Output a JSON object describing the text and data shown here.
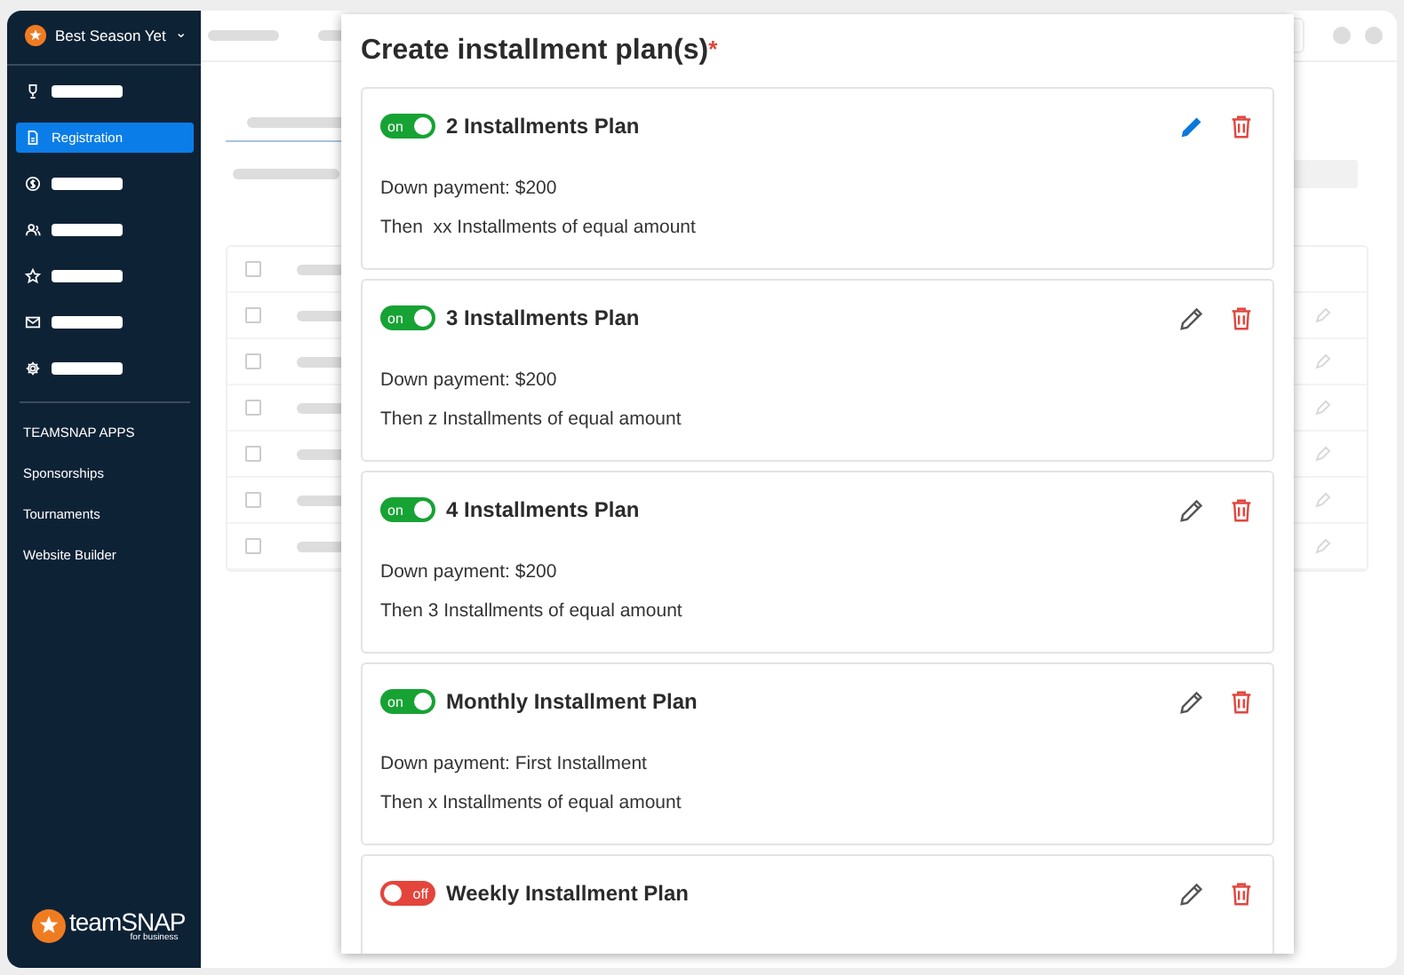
{
  "sidebar": {
    "org": {
      "name": "Best Season Yet",
      "caret": "⌄"
    },
    "nav": [
      {
        "kind": "trophy",
        "selected": false
      },
      {
        "kind": "document",
        "label": "Registration",
        "selected": true
      },
      {
        "kind": "dollar",
        "selected": false
      },
      {
        "kind": "people",
        "selected": false
      },
      {
        "kind": "star",
        "selected": false
      },
      {
        "kind": "mail",
        "selected": false
      },
      {
        "kind": "gear",
        "selected": false
      }
    ],
    "apps_heading": "TEAMSNAP APPS",
    "apps": [
      "Sponsorships",
      "Tournaments",
      "Website Builder"
    ],
    "logo": {
      "name": "team**SNAP**",
      "tagline": "for business"
    }
  },
  "modal": {
    "title": "Create installment plan(s)",
    "required_mark": "*",
    "plans": [
      {
        "on": true,
        "toggle_label": "on",
        "title": "2 Installments Plan",
        "edit_active": true,
        "lines": [
          "Down payment: $200",
          "Then  xx Installments of equal amount"
        ]
      },
      {
        "on": true,
        "toggle_label": "on",
        "title": "3 Installments Plan",
        "edit_active": false,
        "lines": [
          "Down payment: $200",
          "Then z Installments of equal amount"
        ]
      },
      {
        "on": true,
        "toggle_label": "on",
        "title": "4 Installments Plan",
        "edit_active": false,
        "lines": [
          "Down payment: $200",
          "Then 3 Installments of equal amount"
        ]
      },
      {
        "on": true,
        "toggle_label": "on",
        "title": "Monthly Installment Plan",
        "edit_active": false,
        "lines": [
          "Down payment: First Installment",
          "Then x Installments of equal amount"
        ]
      },
      {
        "on": false,
        "toggle_label": "off",
        "title": "Weekly Installment Plan",
        "edit_active": false
      }
    ]
  }
}
